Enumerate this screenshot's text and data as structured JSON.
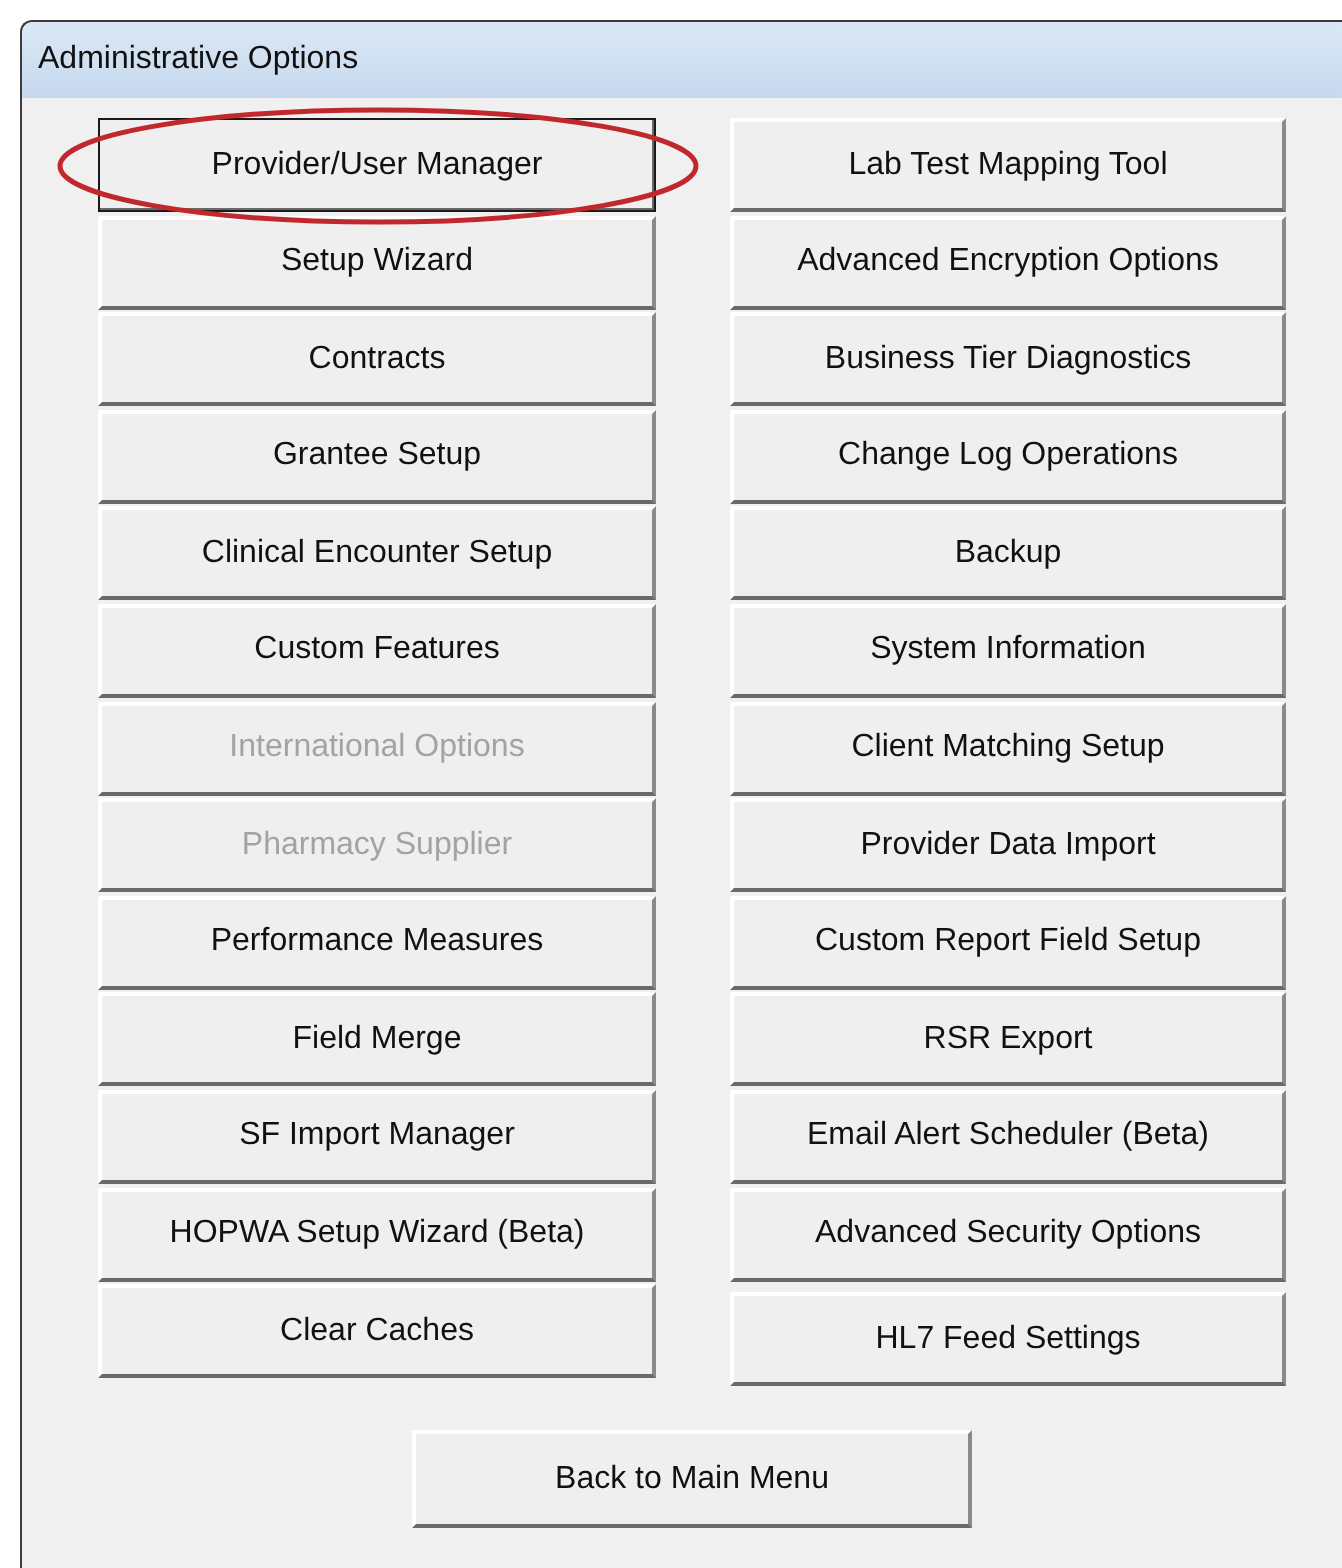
{
  "window": {
    "title": "Administrative Options"
  },
  "left_buttons": [
    {
      "label": "Provider/User Manager",
      "disabled": false,
      "focused": true,
      "circled": true
    },
    {
      "label": "Setup Wizard",
      "disabled": false,
      "focused": false,
      "circled": false
    },
    {
      "label": "Contracts",
      "disabled": false,
      "focused": false,
      "circled": false
    },
    {
      "label": "Grantee Setup",
      "disabled": false,
      "focused": false,
      "circled": false
    },
    {
      "label": "Clinical Encounter Setup",
      "disabled": false,
      "focused": false,
      "circled": false
    },
    {
      "label": "Custom Features",
      "disabled": false,
      "focused": false,
      "circled": false
    },
    {
      "label": "International Options",
      "disabled": true,
      "focused": false,
      "circled": false
    },
    {
      "label": "Pharmacy Supplier",
      "disabled": true,
      "focused": false,
      "circled": false
    },
    {
      "label": "Performance Measures",
      "disabled": false,
      "focused": false,
      "circled": false
    },
    {
      "label": "Field Merge",
      "disabled": false,
      "focused": false,
      "circled": false
    },
    {
      "label": "SF Import Manager",
      "disabled": false,
      "focused": false,
      "circled": false
    },
    {
      "label": "HOPWA Setup Wizard (Beta)",
      "disabled": false,
      "focused": false,
      "circled": false
    },
    {
      "label": "Clear Caches",
      "disabled": false,
      "focused": false,
      "circled": false
    }
  ],
  "right_buttons": [
    {
      "label": "Lab Test Mapping Tool",
      "disabled": false,
      "focused": false,
      "circled": false
    },
    {
      "label": "Advanced Encryption Options",
      "disabled": false,
      "focused": false,
      "circled": false
    },
    {
      "label": "Business Tier Diagnostics",
      "disabled": false,
      "focused": false,
      "circled": false
    },
    {
      "label": "Change Log Operations",
      "disabled": false,
      "focused": false,
      "circled": false
    },
    {
      "label": "Backup",
      "disabled": false,
      "focused": false,
      "circled": false
    },
    {
      "label": "System Information",
      "disabled": false,
      "focused": false,
      "circled": false
    },
    {
      "label": "Client Matching Setup",
      "disabled": false,
      "focused": false,
      "circled": false
    },
    {
      "label": "Provider Data Import",
      "disabled": false,
      "focused": false,
      "circled": false
    },
    {
      "label": "Custom Report Field Setup",
      "disabled": false,
      "focused": false,
      "circled": false
    },
    {
      "label": "RSR Export",
      "disabled": false,
      "focused": false,
      "circled": false
    },
    {
      "label": "Email Alert Scheduler (Beta)",
      "disabled": false,
      "focused": false,
      "circled": false
    },
    {
      "label": "Advanced Security Options",
      "disabled": false,
      "focused": false,
      "circled": false
    },
    {
      "label": "HL7 Feed Settings",
      "disabled": false,
      "focused": false,
      "circled": false
    }
  ],
  "back_button": {
    "label": "Back to Main Menu"
  }
}
